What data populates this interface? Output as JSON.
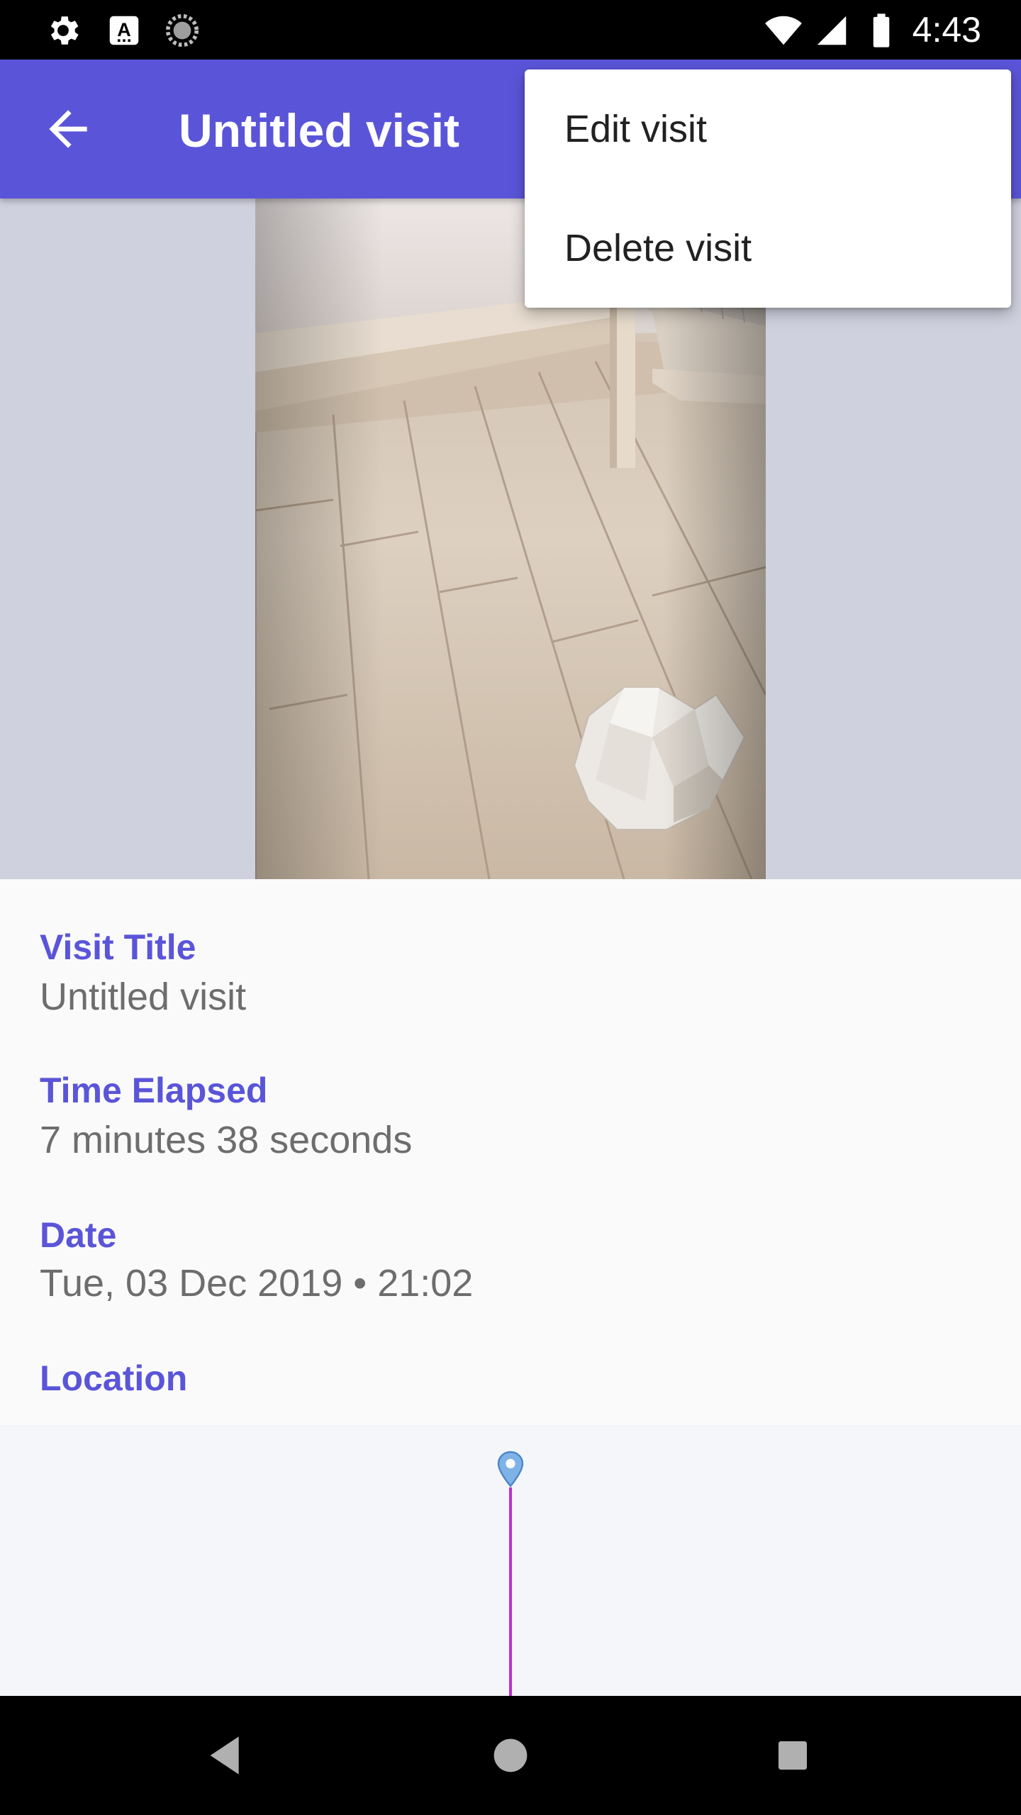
{
  "status_bar": {
    "time": "4:43",
    "left_icons": [
      "gear-icon",
      "keyboard-a-icon",
      "sync-spinner-icon"
    ],
    "right_icons": [
      "wifi-icon",
      "signal-icon",
      "battery-icon"
    ]
  },
  "app_bar": {
    "title": "Untitled visit",
    "accent_color": "#5a55d8"
  },
  "overflow_menu": {
    "items": [
      {
        "label": "Edit visit"
      },
      {
        "label": "Delete visit"
      }
    ]
  },
  "details": {
    "visit_title": {
      "label": "Visit Title",
      "value": "Untitled visit"
    },
    "time_elapsed": {
      "label": "Time Elapsed",
      "value": "7 minutes 38 seconds"
    },
    "date": {
      "label": "Date",
      "value": "Tue, 03 Dec 2019 • 21:02"
    },
    "location": {
      "label": "Location"
    }
  },
  "map": {
    "route_color": "#c12fd2",
    "pin_color": "#7fb3e8"
  },
  "nav_bar": {
    "buttons": [
      "back-triangle-icon",
      "home-circle-icon",
      "recents-square-icon"
    ]
  }
}
